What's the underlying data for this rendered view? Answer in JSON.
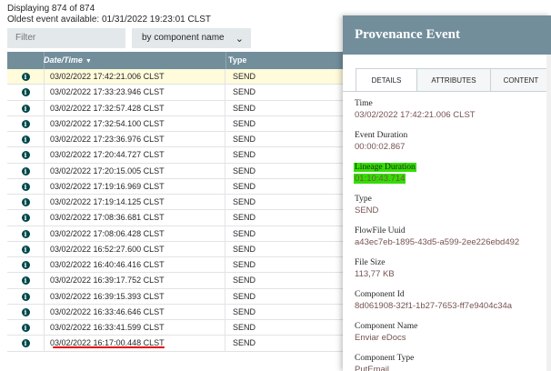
{
  "summary": {
    "displaying": "Displaying 874 of 874",
    "oldest": "Oldest event available: 01/31/2022 19:23:01 CLST"
  },
  "filter": {
    "placeholder": "Filter",
    "by": "by component name"
  },
  "table": {
    "columns": {
      "date": "Date/Time",
      "type": "Type"
    },
    "rows": [
      {
        "date": "03/02/2022 17:42:21.006 CLST",
        "type": "SEND"
      },
      {
        "date": "03/02/2022 17:33:23.946 CLST",
        "type": "SEND"
      },
      {
        "date": "03/02/2022 17:32:57.428 CLST",
        "type": "SEND"
      },
      {
        "date": "03/02/2022 17:32:54.100 CLST",
        "type": "SEND"
      },
      {
        "date": "03/02/2022 17:23:36.976 CLST",
        "type": "SEND"
      },
      {
        "date": "03/02/2022 17:20:44.727 CLST",
        "type": "SEND"
      },
      {
        "date": "03/02/2022 17:20:15.005 CLST",
        "type": "SEND"
      },
      {
        "date": "03/02/2022 17:19:16.969 CLST",
        "type": "SEND"
      },
      {
        "date": "03/02/2022 17:19:14.125 CLST",
        "type": "SEND"
      },
      {
        "date": "03/02/2022 17:08:36.681 CLST",
        "type": "SEND"
      },
      {
        "date": "03/02/2022 17:08:06.428 CLST",
        "type": "SEND"
      },
      {
        "date": "03/02/2022 16:52:27.600 CLST",
        "type": "SEND"
      },
      {
        "date": "03/02/2022 16:40:46.416 CLST",
        "type": "SEND"
      },
      {
        "date": "03/02/2022 16:39:17.752 CLST",
        "type": "SEND"
      },
      {
        "date": "03/02/2022 16:39:15.393 CLST",
        "type": "SEND"
      },
      {
        "date": "03/02/2022 16:33:46.646 CLST",
        "type": "SEND"
      },
      {
        "date": "03/02/2022 16:33:41.599 CLST",
        "type": "SEND"
      },
      {
        "date": "03/02/2022 16:17:00.448 CLST",
        "type": "SEND"
      }
    ]
  },
  "dialog": {
    "title": "Provenance Event",
    "tabs": [
      "DETAILS",
      "ATTRIBUTES",
      "CONTENT"
    ],
    "fields": [
      {
        "label": "Time",
        "value": "03/02/2022 17:42:21.006 CLST"
      },
      {
        "label": "Event Duration",
        "value": "00:00:02.867"
      },
      {
        "label": "Lineage Duration",
        "value": "01:10:43.714"
      },
      {
        "label": "Type",
        "value": "SEND"
      },
      {
        "label": "FlowFile Uuid",
        "value": "a43ec7eb-1895-43d5-a599-2ee226ebd492"
      },
      {
        "label": "File Size",
        "value": "113,77 KB"
      },
      {
        "label": "Component Id",
        "value": "8d061908-32f1-1b27-7653-ff7e9404c34a"
      },
      {
        "label": "Component Name",
        "value": "Enviar eDocs"
      },
      {
        "label": "Component Type",
        "value": "PutEmail"
      }
    ]
  },
  "colors": {
    "header": "#728e9b",
    "highlight": "#33dd00",
    "selected_row": "#fffbdb",
    "annotation": "#e00000"
  },
  "icons": {
    "row": "info-icon",
    "sort": "sort-down-icon",
    "select": "chevron-down-icon"
  }
}
